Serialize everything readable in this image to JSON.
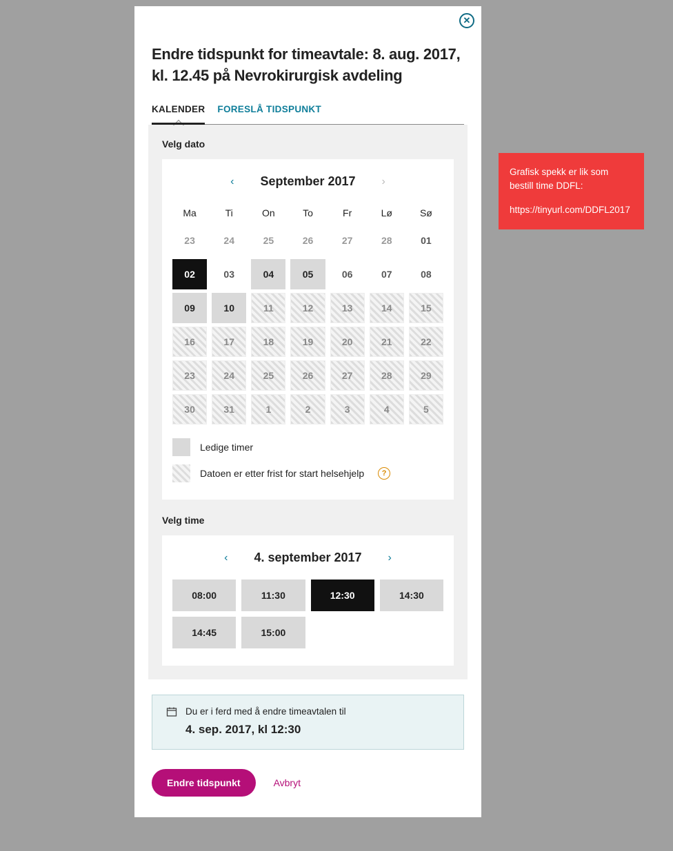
{
  "title": "Endre tidspunkt for timeavtale: 8. aug. 2017, kl. 12.45 på Nevrokirurgisk avdeling",
  "close_label": "✕",
  "tabs": {
    "calendar": "KALENDER",
    "suggest": "FORESLÅ TIDSPUNKT"
  },
  "sections": {
    "select_date": "Velg dato",
    "select_time": "Velg time"
  },
  "month_nav": {
    "label": "September 2017"
  },
  "dow": [
    "Ma",
    "Ti",
    "On",
    "To",
    "Fr",
    "Lø",
    "Sø"
  ],
  "weeks": [
    [
      {
        "d": "23",
        "s": "out"
      },
      {
        "d": "24",
        "s": "out"
      },
      {
        "d": "25",
        "s": "out"
      },
      {
        "d": "26",
        "s": "out"
      },
      {
        "d": "27",
        "s": "out"
      },
      {
        "d": "28",
        "s": "out"
      },
      {
        "d": "01",
        "s": "plain"
      }
    ],
    [
      {
        "d": "02",
        "s": "selected"
      },
      {
        "d": "03",
        "s": "plain"
      },
      {
        "d": "04",
        "s": "avail"
      },
      {
        "d": "05",
        "s": "avail"
      },
      {
        "d": "06",
        "s": "plain"
      },
      {
        "d": "07",
        "s": "plain"
      },
      {
        "d": "08",
        "s": "plain"
      }
    ],
    [
      {
        "d": "09",
        "s": "avail"
      },
      {
        "d": "10",
        "s": "avail"
      },
      {
        "d": "11",
        "s": "hatched"
      },
      {
        "d": "12",
        "s": "hatched"
      },
      {
        "d": "13",
        "s": "hatched"
      },
      {
        "d": "14",
        "s": "hatched"
      },
      {
        "d": "15",
        "s": "hatched"
      }
    ],
    [
      {
        "d": "16",
        "s": "hatched"
      },
      {
        "d": "17",
        "s": "hatched"
      },
      {
        "d": "18",
        "s": "hatched"
      },
      {
        "d": "19",
        "s": "hatched"
      },
      {
        "d": "20",
        "s": "hatched"
      },
      {
        "d": "21",
        "s": "hatched"
      },
      {
        "d": "22",
        "s": "hatched"
      }
    ],
    [
      {
        "d": "23",
        "s": "hatched"
      },
      {
        "d": "24",
        "s": "hatched"
      },
      {
        "d": "25",
        "s": "hatched"
      },
      {
        "d": "26",
        "s": "hatched"
      },
      {
        "d": "27",
        "s": "hatched"
      },
      {
        "d": "28",
        "s": "hatched"
      },
      {
        "d": "29",
        "s": "hatched"
      }
    ],
    [
      {
        "d": "30",
        "s": "hatched"
      },
      {
        "d": "31",
        "s": "hatched"
      },
      {
        "d": "1",
        "s": "hatched"
      },
      {
        "d": "2",
        "s": "hatched"
      },
      {
        "d": "3",
        "s": "hatched"
      },
      {
        "d": "4",
        "s": "hatched"
      },
      {
        "d": "5",
        "s": "hatched"
      }
    ]
  ],
  "legend": {
    "available": "Ledige timer",
    "past_deadline": "Datoen er etter frist for start helsehjelp",
    "help": "?"
  },
  "time_nav": {
    "label": "4. september 2017"
  },
  "time_slots": [
    {
      "t": "08:00",
      "s": "avail"
    },
    {
      "t": "11:30",
      "s": "avail"
    },
    {
      "t": "12:30",
      "s": "selected"
    },
    {
      "t": "14:30",
      "s": "avail"
    },
    {
      "t": "14:45",
      "s": "avail"
    },
    {
      "t": "15:00",
      "s": "avail"
    }
  ],
  "summary": {
    "lead": "Du er i ferd med å endre timeavtalen til",
    "value": "4. sep. 2017, kl 12:30"
  },
  "actions": {
    "primary": "Endre tidspunkt",
    "cancel": "Avbryt"
  },
  "sidenote": {
    "text": "Grafisk spekk er lik som bestill time DDFL:",
    "link": "https://tinyurl.com/DDFL2017"
  }
}
